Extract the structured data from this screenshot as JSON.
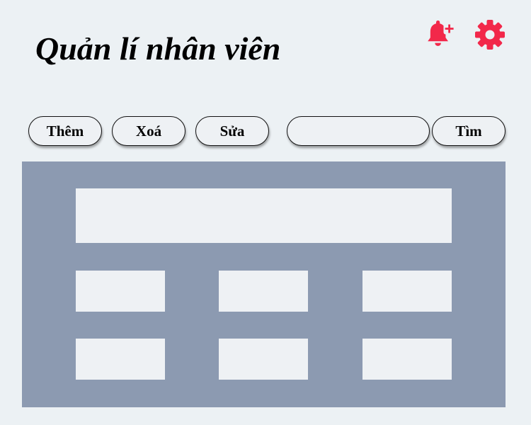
{
  "header": {
    "title": "Quản lí nhân viên",
    "icons": {
      "notification": "bell-plus-icon",
      "settings": "gear-icon",
      "color": "#F2284A"
    }
  },
  "toolbar": {
    "add_label": "Thêm",
    "delete_label": "Xoá",
    "edit_label": "Sửa",
    "search_value": "",
    "search_button_label": "Tìm"
  },
  "colors": {
    "background": "#ECF1F4",
    "panel": "#8C9AB1",
    "block": "#EEF1F4"
  }
}
